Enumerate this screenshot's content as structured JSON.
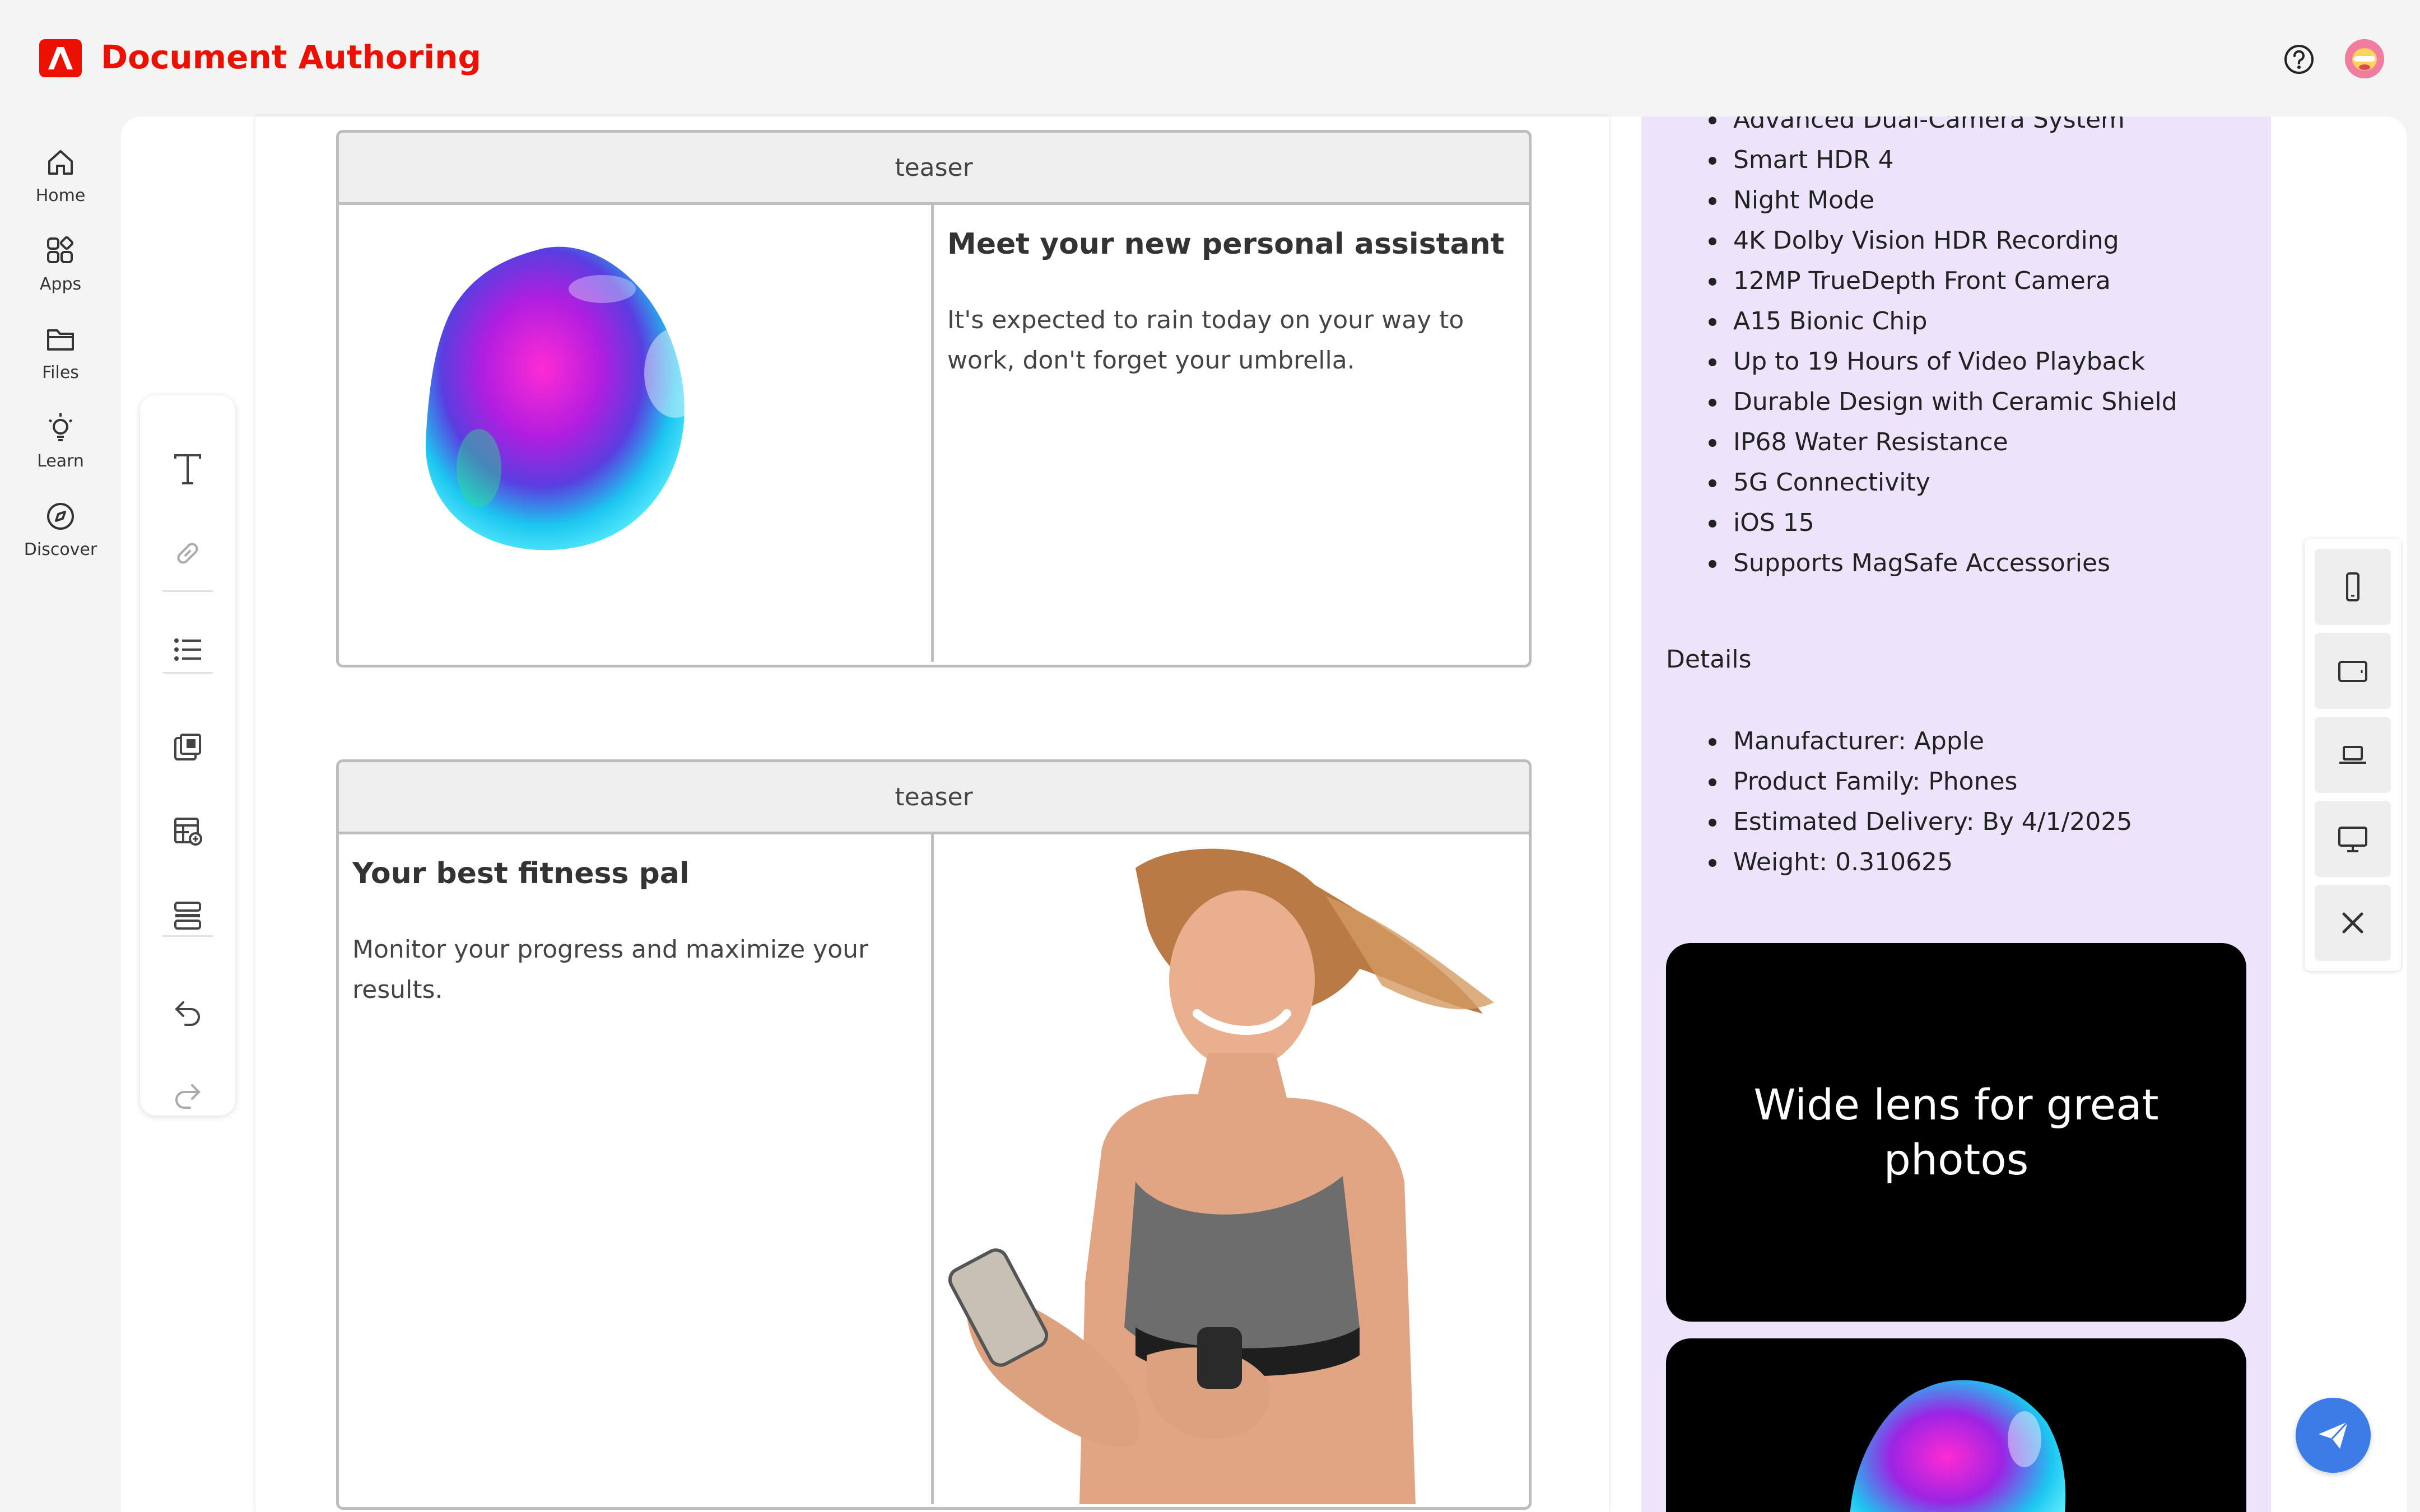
{
  "app": {
    "title": "Document Authoring"
  },
  "nav": [
    {
      "label": "Home",
      "icon": "home-icon"
    },
    {
      "label": "Apps",
      "icon": "apps-icon"
    },
    {
      "label": "Files",
      "icon": "folder-icon"
    },
    {
      "label": "Learn",
      "icon": "lightbulb-icon"
    },
    {
      "label": "Discover",
      "icon": "compass-icon"
    }
  ],
  "toolbar": {
    "tools": [
      "text-icon",
      "link-icon",
      "list-icon",
      "copy-block-icon",
      "insert-table-icon",
      "section-icon",
      "undo-icon",
      "redo-icon"
    ]
  },
  "editor": {
    "teasers": [
      {
        "block_name": "teaser",
        "title": "Meet your new personal assistant",
        "text": "It's expected to rain today on your way to work, don't forget your umbrella."
      },
      {
        "block_name": "teaser",
        "title": "Your best fitness pal",
        "text": "Monitor your progress and maximize your results."
      }
    ]
  },
  "preview": {
    "features": [
      "Advanced Dual-Camera System",
      "Smart HDR 4",
      "Night Mode",
      "4K Dolby Vision HDR Recording",
      "12MP TrueDepth Front Camera",
      "A15 Bionic Chip",
      "Up to 19 Hours of Video Playback",
      "Durable Design with Ceramic Shield",
      "IP68 Water Resistance",
      "5G Connectivity",
      "iOS 15",
      "Supports MagSafe Accessories"
    ],
    "details_heading": "Details",
    "details": [
      "Manufacturer: Apple",
      "Product Family: Phones",
      "Estimated Delivery: By 4/1/2025",
      "Weight: 0.310625"
    ],
    "card_title": "Wide lens for great photos"
  },
  "device_switcher": [
    "mobile-icon",
    "tablet-icon",
    "laptop-icon",
    "desktop-icon",
    "close-icon"
  ],
  "colors": {
    "brand": "#eb1000",
    "preview_bg": "#ede3fb",
    "send": "#3c7ce6"
  }
}
